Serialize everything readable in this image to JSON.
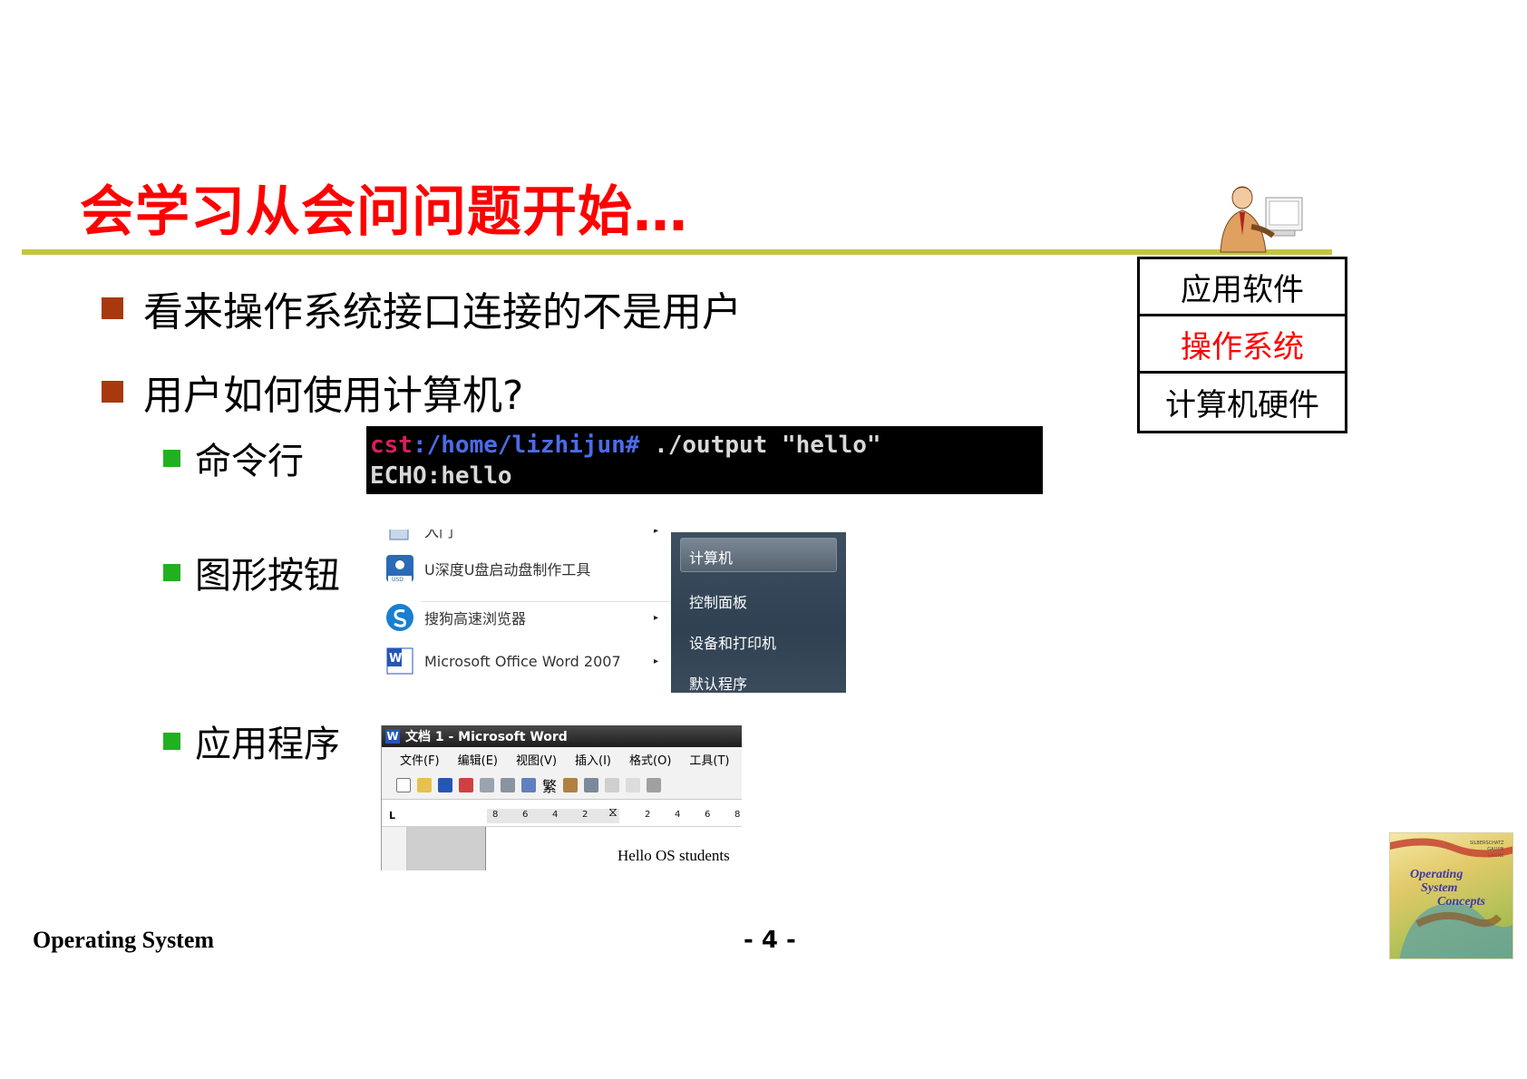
{
  "slide": {
    "title": "会学习从会问问题开始…",
    "bullets": [
      "看来操作系统接口连接的不是用户",
      "用户如何使用计算机?"
    ],
    "sub_bullets": [
      "命令行",
      "图形按钮",
      "应用程序"
    ]
  },
  "layers": [
    "应用软件",
    "操作系统",
    "计算机硬件"
  ],
  "terminal": {
    "user": "cst",
    "path": ":/home/lizhijun#",
    "command": " ./output \"hello\"",
    "output": "ECHO:hello"
  },
  "start_menu": {
    "items": [
      {
        "label": "入门",
        "icon": "getting-started-icon"
      },
      {
        "label": "U深度U盘启动盘制作工具",
        "icon": "usb-tool-icon"
      },
      {
        "label": "搜狗高速浏览器",
        "icon": "sogou-browser-icon"
      },
      {
        "label": "Microsoft Office Word 2007",
        "icon": "word-icon"
      }
    ],
    "right_items": [
      "计算机",
      "控制面板",
      "设备和打印机",
      "默认程序"
    ]
  },
  "word_window": {
    "title": "文档 1 - Microsoft Word",
    "menu": [
      "文件(F)",
      "编辑(E)",
      "视图(V)",
      "插入(I)",
      "格式(O)",
      "工具(T)"
    ],
    "toolbar_char": "繁",
    "ruler_numbers": [
      "8",
      "6",
      "4",
      "2",
      "2",
      "4",
      "6",
      "8"
    ],
    "document_text": "Hello OS students"
  },
  "footer": {
    "left": "Operating System",
    "page": "- 4 -"
  },
  "book_cover": {
    "title_lines": [
      "Operating",
      "System",
      "Concepts"
    ],
    "authors": [
      "SILBERSCHATZ",
      "GALVIN",
      "GAGNE"
    ]
  },
  "colors": {
    "title": "#ff0000",
    "rule": "#c4c63e",
    "bullet_l1": "#a8380d",
    "bullet_l2": "#22b022",
    "highlight_layer": "#ff0000"
  }
}
